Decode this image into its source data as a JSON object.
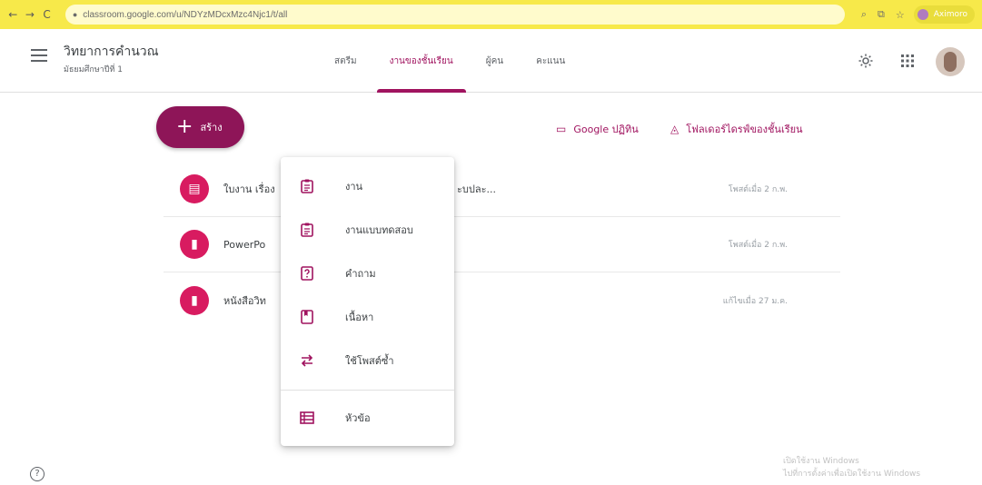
{
  "browser": {
    "url": "classroom.google.com/u/NDYzMDcxMzc4Njc1/t/all",
    "profile_label": "Aximoro"
  },
  "header": {
    "class_name": "วิทยาการคำนวณ",
    "class_sub": "มัธยมศึกษาปีที่ 1",
    "tabs": [
      {
        "label": "สตรีม"
      },
      {
        "label": "งานของชั้นเรียน"
      },
      {
        "label": "ผู้คน"
      },
      {
        "label": "คะแนน"
      }
    ],
    "active_tab": "งานของชั้นเรียน"
  },
  "toolbar": {
    "create_label": "สร้าง",
    "calendar_label": "Google ปฏิทิน",
    "drive_label": "โฟลเดอร์ไดรฟ์ของชั้นเรียน"
  },
  "list": {
    "items": [
      {
        "title": "ใบงาน เรื่อง",
        "title_tail": "ะบปละ...",
        "meta": "โพสต์เมื่อ 2 ก.พ.",
        "icon": "assignment-icon"
      },
      {
        "title": "PowerPo",
        "title_tail": "",
        "meta": "โพสต์เมื่อ 2 ก.พ.",
        "icon": "material-icon"
      },
      {
        "title": "หนังสือวิท",
        "title_tail": "",
        "meta": "แก้ไขเมื่อ 27 ม.ค.",
        "icon": "material-icon"
      }
    ]
  },
  "menu": {
    "items": [
      {
        "label": "งาน",
        "icon": "assignment-icon"
      },
      {
        "label": "งานแบบทดสอบ",
        "icon": "quiz-assignment-icon"
      },
      {
        "label": "คำถาม",
        "icon": "question-icon"
      },
      {
        "label": "เนื้อหา",
        "icon": "material-icon"
      },
      {
        "label": "ใช้โพสต์ซ้ำ",
        "icon": "reuse-post-icon"
      }
    ],
    "topic_label": "หัวข้อ"
  },
  "footer": {
    "watermark_line1": "เปิดใช้งาน Windows",
    "watermark_line2": "ไปที่การตั้งค่าเพื่อเปิดใช้งาน Windows"
  },
  "colors": {
    "accent": "#a0135f",
    "create_button": "#8e1558",
    "row_icon": "#d81b60",
    "browser_bar": "#f7e94a"
  }
}
